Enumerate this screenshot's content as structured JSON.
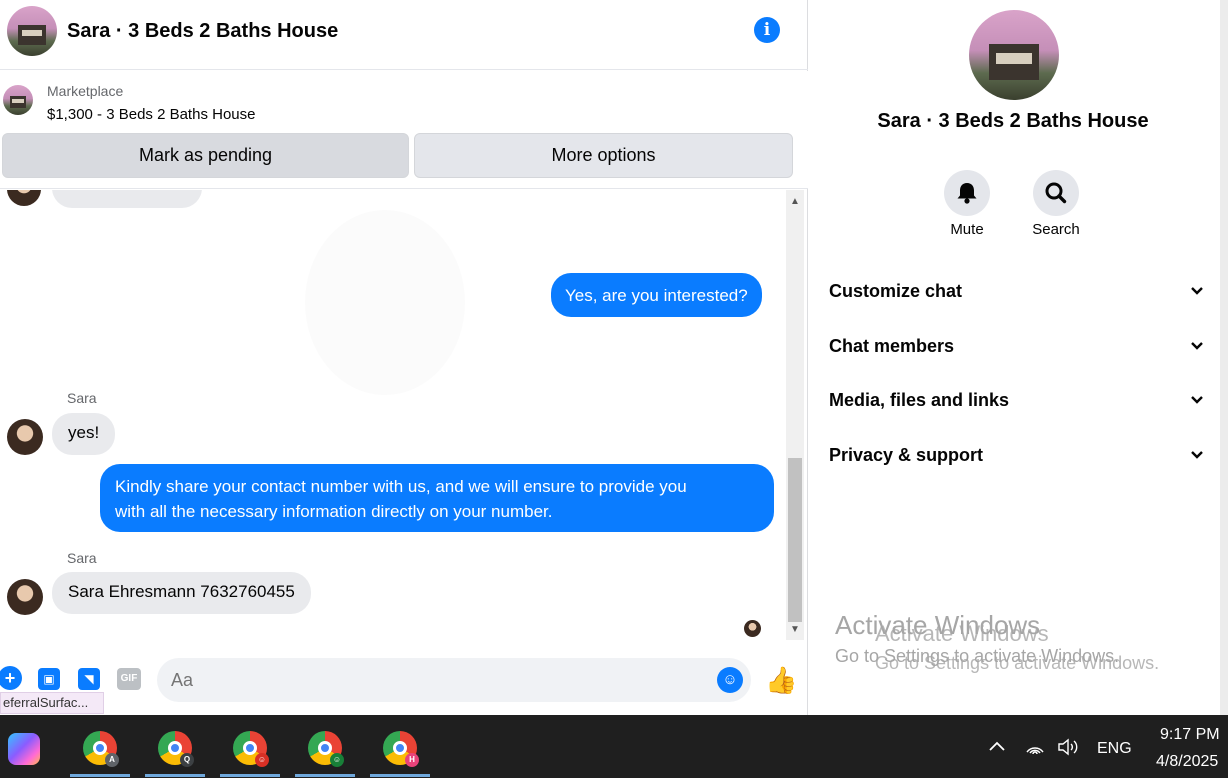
{
  "header": {
    "title": "Sara · 3 Beds 2 Baths House",
    "info_icon": "info-icon"
  },
  "listing": {
    "category": "Marketplace",
    "title": "$1,300 - 3 Beds 2 Baths House",
    "mark_pending_label": "Mark as pending",
    "more_options_label": "More options"
  },
  "messages": {
    "outgoing_1": "Yes, are you interested?",
    "sender_1": "Sara",
    "incoming_1": "yes!",
    "outgoing_2_line1": "Kindly share your contact number with us, and we will ensure to provide you",
    "outgoing_2_line2": "with all the necessary information directly on your number.",
    "sender_2": "Sara",
    "incoming_2": "Sara Ehresmann 7632760455"
  },
  "composer": {
    "placeholder": "Aa",
    "gif_label": "GIF",
    "accent": "#0a7cff"
  },
  "tooltip_tag": "eferralSurfac...",
  "side_panel": {
    "title": "Sara · 3 Beds 2 Baths House",
    "mute_label": "Mute",
    "search_label": "Search",
    "sections": [
      "Customize chat",
      "Chat members",
      "Media, files and links",
      "Privacy & support"
    ]
  },
  "watermark": {
    "title": "Activate Windows",
    "subtitle": "Go to Settings to activate Windows."
  },
  "taskbar": {
    "apps": [
      {
        "badge": "A",
        "badge_color": "#5f6368"
      },
      {
        "badge": "Q",
        "badge_color": "#3c4043"
      },
      {
        "badge": "☺",
        "badge_color": "#d93025"
      },
      {
        "badge": "☺",
        "badge_color": "#188038"
      },
      {
        "badge": "H",
        "badge_color": "#e8437a"
      }
    ],
    "language": "ENG",
    "time": "9:17 PM",
    "date": "4/8/2025"
  }
}
